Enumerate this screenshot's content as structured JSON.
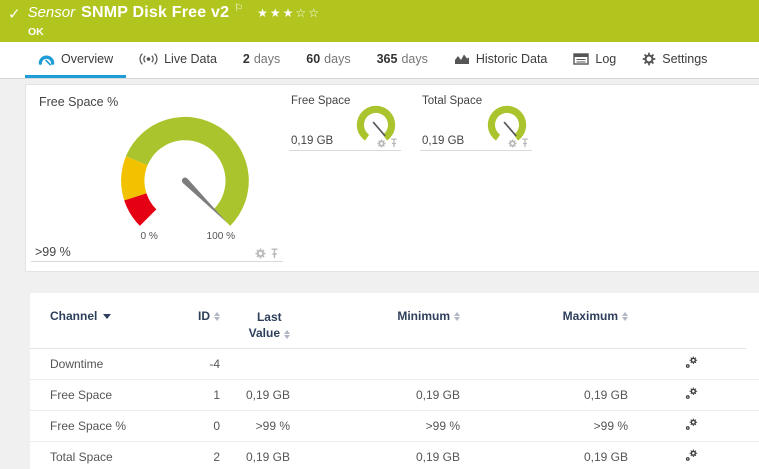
{
  "header": {
    "check_glyph": "✓",
    "kind": "Sensor",
    "title": "SNMP Disk Free v2",
    "flag_glyph": "⚐",
    "stars": "★★★☆☆",
    "rating_filled": 3,
    "rating_total": 5,
    "status": "OK"
  },
  "tabs": {
    "overview": {
      "label": "Overview"
    },
    "live_data": {
      "label": "Live Data"
    },
    "d2": {
      "number": "2",
      "label": "days"
    },
    "d60": {
      "number": "60",
      "label": "days"
    },
    "d365": {
      "number": "365",
      "label": "days"
    },
    "historic": {
      "label": "Historic Data"
    },
    "log": {
      "label": "Log"
    },
    "settings": {
      "label": "Settings"
    }
  },
  "gauges": {
    "main": {
      "title": "Free Space %",
      "value": ">99 %",
      "scale_min": "0 %",
      "scale_max": "100 %",
      "percent": 99.5,
      "segment_colors": {
        "red": "#e60013",
        "yellow": "#f2c100",
        "green": "#a9c42c"
      }
    },
    "free_space": {
      "title": "Free Space",
      "value": "0,19 GB"
    },
    "total_space": {
      "title": "Total Space",
      "value": "0,19 GB"
    }
  },
  "table": {
    "headers": {
      "channel": "Channel",
      "id": "ID",
      "last_line1": "Last",
      "last_line2": "Value",
      "minimum": "Minimum",
      "maximum": "Maximum"
    },
    "rows": [
      {
        "channel": "Downtime",
        "id": "-4",
        "last": "",
        "min": "",
        "max": ""
      },
      {
        "channel": "Free Space",
        "id": "1",
        "last": "0,19 GB",
        "min": "0,19 GB",
        "max": "0,19 GB"
      },
      {
        "channel": "Free Space %",
        "id": "0",
        "last": ">99 %",
        "min": ">99 %",
        "max": ">99 %"
      },
      {
        "channel": "Total Space",
        "id": "2",
        "last": "0,19 GB",
        "min": "0,19 GB",
        "max": "0,19 GB"
      }
    ]
  },
  "colors": {
    "header_green": "#b2c51e",
    "tab_active_blue": "#1e9cd7",
    "gauge_green": "#a9c42c",
    "gauge_yellow": "#f2c100",
    "gauge_red": "#e60013",
    "needle_gray": "#7d7d7d",
    "table_header_navy": "#2e3f5c",
    "content_bg": "#f0f0f0"
  }
}
